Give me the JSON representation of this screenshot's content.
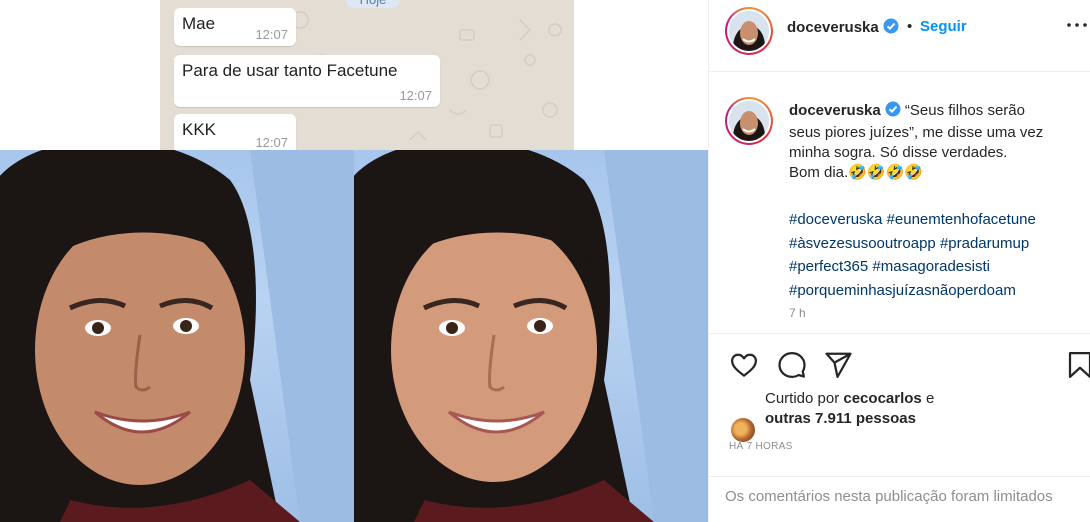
{
  "chat": {
    "day_label": "Hoje",
    "messages": [
      {
        "text": "Mae",
        "time": "12:07"
      },
      {
        "text": "Para de usar tanto Facetune",
        "time": "12:07"
      },
      {
        "text": "KKK",
        "time": "12:07"
      }
    ]
  },
  "post": {
    "username": "doceveruska",
    "separator": "•",
    "follow_label": "Seguir",
    "caption_lines": [
      "“Seus filhos serão",
      "seus piores juízes”, me disse uma vez",
      "minha sogra. Só disse verdades.",
      "Bom dia.🤣🤣🤣🤣"
    ],
    "hashtag_lines": [
      "#doceveruska #eunemtenhofacetune",
      "#àsvezesusooutroapp #pradarumup",
      "#perfect365 #masagoradesisti",
      "#porqueminhasjuízasnãoperdoam"
    ],
    "age": "7 h",
    "liked_by_prefix": "Curtido por",
    "liked_by_user": "cecocarlos",
    "liked_by_and": "e",
    "others_count": "outras 7.911 pessoas",
    "time_ago": "HÁ 7 HORAS",
    "comments_limited": "Os comentários nesta publicação foram limitados"
  },
  "icons": {
    "like": "heart-icon",
    "comment": "comment-icon",
    "share": "share-icon",
    "save": "bookmark-icon",
    "verified": "verified-badge-icon",
    "more": "more-options-icon"
  },
  "colors": {
    "link_blue": "#0095f6",
    "hashtag_blue": "#00376b",
    "muted": "#8e8e8e",
    "verified": "#3897f0"
  }
}
